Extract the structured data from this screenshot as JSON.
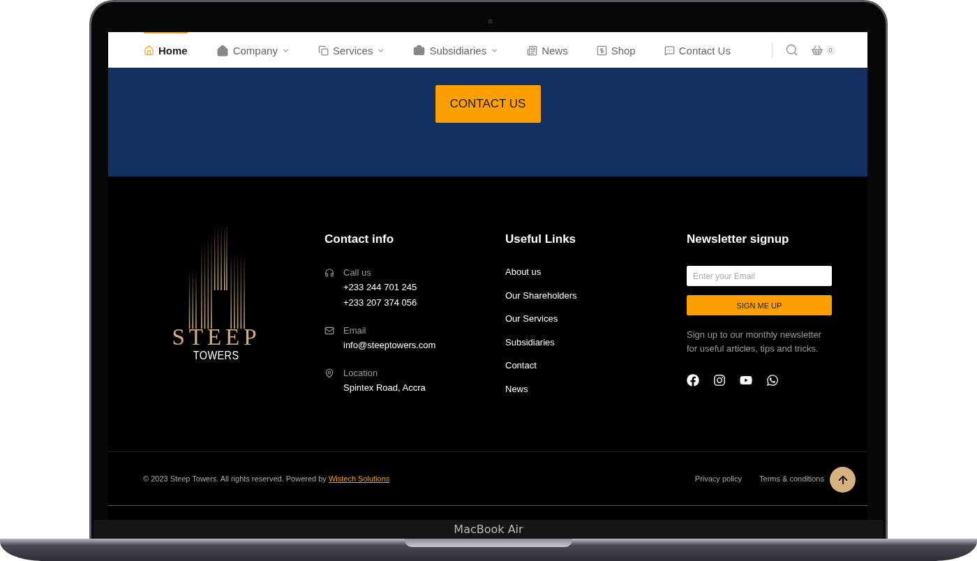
{
  "device": {
    "label": "MacBook Air"
  },
  "nav": {
    "items": [
      {
        "label": "Home",
        "dropdown": false,
        "selected": true
      },
      {
        "label": "Company",
        "dropdown": true,
        "selected": false
      },
      {
        "label": "Services",
        "dropdown": true,
        "selected": false
      },
      {
        "label": "Subsidiaries",
        "dropdown": true,
        "selected": false
      },
      {
        "label": "News",
        "dropdown": false,
        "selected": false
      },
      {
        "label": "Shop",
        "dropdown": false,
        "selected": false
      },
      {
        "label": "Contact Us",
        "dropdown": false,
        "selected": false
      }
    ],
    "cart_count": "0"
  },
  "cta": {
    "button": "CONTACT US"
  },
  "footer": {
    "logo": {
      "name": "STEEP",
      "sub": "TOWERS"
    },
    "contact": {
      "title": "Contact info",
      "groups": [
        {
          "label": "Call us",
          "values": [
            "+233 244 701 245",
            "+233 207 374 056"
          ]
        },
        {
          "label": "Email",
          "values": [
            "info@steeptowers.com"
          ]
        },
        {
          "label": "Location",
          "values": [
            "Spintex Road, Accra"
          ]
        }
      ]
    },
    "links": {
      "title": "Useful Links",
      "items": [
        "About us",
        "Our Shareholders",
        "Our Services",
        "Subsidiaries",
        "Contact",
        "News"
      ]
    },
    "newsletter": {
      "title": "Newsletter signup",
      "placeholder": "Enter your Email",
      "button": "SIGN ME UP",
      "text": "Sign up to our monthly newsletter for useful articles, tips and tricks."
    },
    "bottom": {
      "copyright": "© 2023 Steep Towers. All rights reserved. Powered by",
      "credit": "Wistech Solutions",
      "legal": [
        "Privacy policy",
        "Terms & conditions"
      ]
    }
  }
}
